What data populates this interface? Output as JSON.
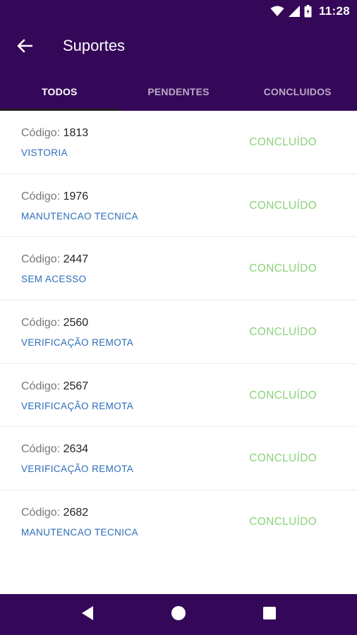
{
  "status_bar": {
    "time": "11:28"
  },
  "app_bar": {
    "title": "Suportes"
  },
  "tabs": [
    {
      "label": "TODOS",
      "active": true
    },
    {
      "label": "PENDENTES",
      "active": false
    },
    {
      "label": "CONCLUIDOS",
      "active": false
    }
  ],
  "code_label": "Código:",
  "items": [
    {
      "code": "1813",
      "type": "VISTORIA",
      "status": "CONCLUÍDO"
    },
    {
      "code": "1976",
      "type": "MANUTENCAO TECNICA",
      "status": "CONCLUÍDO"
    },
    {
      "code": "2447",
      "type": "SEM ACESSO",
      "status": "CONCLUÍDO"
    },
    {
      "code": "2560",
      "type": "VERIFICAÇÃO REMOTA",
      "status": "CONCLUÍDO"
    },
    {
      "code": "2567",
      "type": "VERIFICAÇÃO REMOTA",
      "status": "CONCLUÍDO"
    },
    {
      "code": "2634",
      "type": "VERIFICAÇÃO REMOTA",
      "status": "CONCLUÍDO"
    },
    {
      "code": "2682",
      "type": "MANUTENCAO TECNICA",
      "status": "CONCLUÍDO"
    }
  ],
  "colors": {
    "primary": "#350758",
    "status_done": "#8bd27a",
    "type_link": "#2b6cb8"
  },
  "icons": {
    "status_bar": [
      "wifi-icon",
      "signal-icon",
      "battery-icon"
    ],
    "app_bar": "back-arrow-icon",
    "nav_bar": [
      "nav-back-icon",
      "nav-home-icon",
      "nav-recents-icon"
    ]
  }
}
